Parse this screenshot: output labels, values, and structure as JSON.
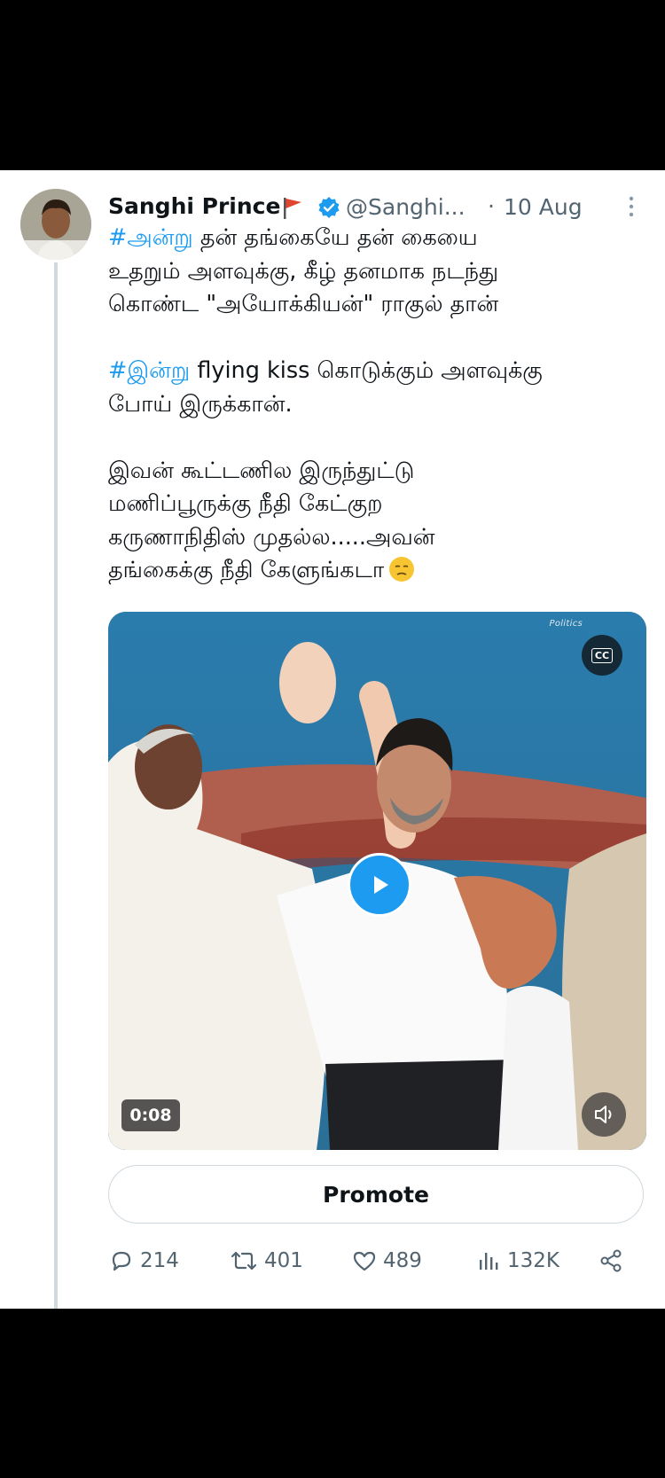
{
  "tweet": {
    "display_name": "Sanghi Prince",
    "handle": "@Sanghi...",
    "separator": "·",
    "date": "10 Aug",
    "text_lines": [
      {
        "hashtag": "#அன்று",
        "rest": " தன் தங்கையே தன் கையை"
      },
      {
        "hashtag": "",
        "rest": "உதறும் அளவுக்கு, கீழ் தனமாக நடந்து"
      },
      {
        "hashtag": "",
        "rest": "கொண்ட \"அயோக்கியன்\" ராகுல் தான்"
      },
      {
        "hashtag": "#இன்று",
        "rest": " flying kiss கொடுக்கும் அளவுக்கு"
      },
      {
        "hashtag": "",
        "rest": "போய் இருக்கான்."
      },
      {
        "hashtag": "",
        "rest": "இவன் கூட்டணில இருந்துட்டு"
      },
      {
        "hashtag": "",
        "rest": "மணிப்பூருக்கு நீதி கேட்குற"
      },
      {
        "hashtag": "",
        "rest": "கருணாநிதிஸ் முதல்ல.....அவன்"
      },
      {
        "hashtag": "",
        "rest": "தங்கைக்கு நீதி கேளுங்கடா"
      }
    ],
    "emoji": "unamused-face-emoji"
  },
  "media": {
    "source_tag": "Politics",
    "cc_label": "CC",
    "duration": "0:08",
    "play_icon": "play-icon",
    "mute_icon": "speaker-icon"
  },
  "promote_label": "Promote",
  "actions": {
    "replies": "214",
    "retweets": "401",
    "likes": "489",
    "views": "132K"
  },
  "colors": {
    "accent": "#1d9bf0",
    "text": "#0f1419",
    "secondary": "#536471"
  }
}
